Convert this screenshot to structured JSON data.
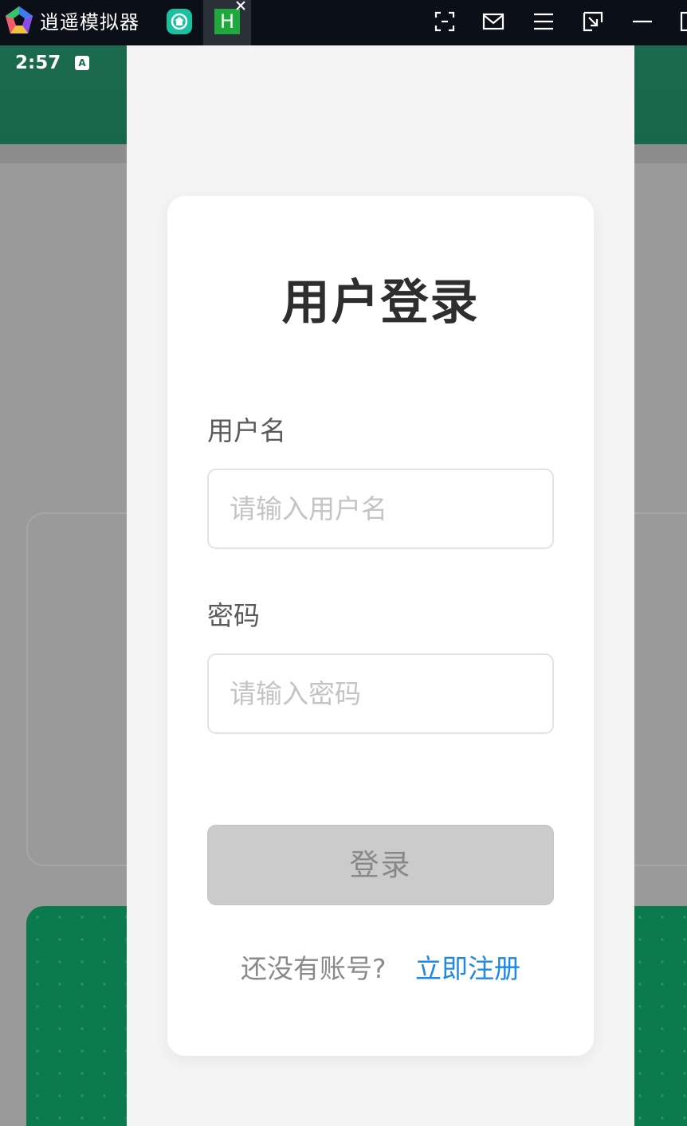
{
  "emulator": {
    "app_title": "逍遥模拟器",
    "tabs": [
      {
        "name": "home",
        "icon": "home-icon"
      },
      {
        "name": "app",
        "label": "H"
      }
    ],
    "toolbar_icons": [
      "screenshot-icon",
      "mail-icon",
      "menu-icon",
      "minimize-to-tray-icon",
      "minimize-icon",
      "maximize-icon"
    ]
  },
  "status_bar": {
    "time": "2:57",
    "indicator": "A"
  },
  "login": {
    "title": "用户登录",
    "username_label": "用户名",
    "username_placeholder": "请输入用户名",
    "username_value": "",
    "password_label": "密码",
    "password_placeholder": "请输入密码",
    "password_value": "",
    "submit_label": "登录",
    "register_prompt": "还没有账号?",
    "register_link": "立即注册"
  },
  "colors": {
    "brand_green": "#1b6a4d",
    "link_blue": "#1e88e5",
    "button_disabled": "#cbcbcb"
  }
}
